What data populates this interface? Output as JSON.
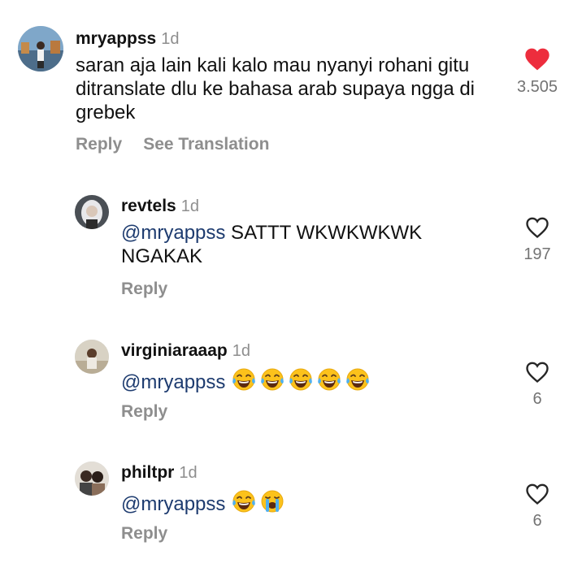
{
  "comments": [
    {
      "username": "mryappss",
      "time": "1d",
      "text": "saran aja lain kali kalo mau nyanyi rohani gitu ditranslate dlu ke bahasa arab supaya ngga di grebek",
      "reply_label": "Reply",
      "translate_label": "See Translation",
      "likes": "3.505",
      "liked": true
    },
    {
      "username": "revtels",
      "time": "1d",
      "mention": "@mryappss",
      "text": " SATTT WKWKWKWK NGAKAK",
      "reply_label": "Reply",
      "likes": "197",
      "liked": false
    },
    {
      "username": "virginiaraaap",
      "time": "1d",
      "mention": "@mryappss",
      "emojis": [
        "tears-of-joy",
        "tears-of-joy",
        "tears-of-joy",
        "tears-of-joy",
        "tears-of-joy"
      ],
      "reply_label": "Reply",
      "likes": "6",
      "liked": false
    },
    {
      "username": "philtpr",
      "time": "1d",
      "mention": "@mryappss",
      "emojis": [
        "tears-of-joy",
        "loudly-crying"
      ],
      "reply_label": "Reply",
      "likes": "6",
      "liked": false
    }
  ],
  "colors": {
    "heart_liked": "#ed2d3d",
    "mention": "#1d3b6f",
    "muted": "#8e8e8e"
  }
}
